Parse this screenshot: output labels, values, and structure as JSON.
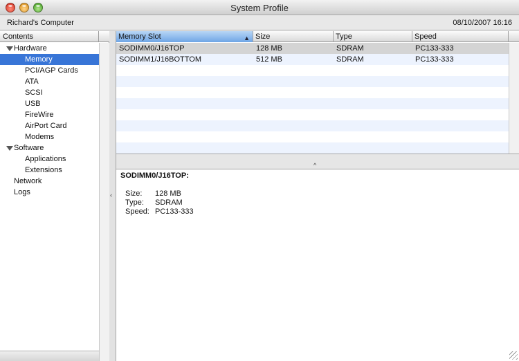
{
  "window": {
    "title": "System Profile"
  },
  "info": {
    "computer_name": "Richard's Computer",
    "datetime": "08/10/2007 16:16"
  },
  "sidebar": {
    "header": "Contents",
    "items": [
      {
        "label": "Hardware",
        "level": 0,
        "expanded": true
      },
      {
        "label": "Memory",
        "level": 1,
        "selected": true
      },
      {
        "label": "PCI/AGP Cards",
        "level": 1
      },
      {
        "label": "ATA",
        "level": 1
      },
      {
        "label": "SCSI",
        "level": 1
      },
      {
        "label": "USB",
        "level": 1
      },
      {
        "label": "FireWire",
        "level": 1
      },
      {
        "label": "AirPort Card",
        "level": 1
      },
      {
        "label": "Modems",
        "level": 1
      },
      {
        "label": "Software",
        "level": 0,
        "expanded": true
      },
      {
        "label": "Applications",
        "level": 1
      },
      {
        "label": "Extensions",
        "level": 1
      },
      {
        "label": "Network",
        "level": 0
      },
      {
        "label": "Logs",
        "level": 0
      }
    ]
  },
  "table": {
    "columns": [
      "Memory Slot",
      "Size",
      "Type",
      "Speed"
    ],
    "sort_indicator": "▲",
    "rows": [
      [
        "SODIMM0/J16TOP",
        "128 MB",
        "SDRAM",
        "PC133-333"
      ],
      [
        "SODIMM1/J16BOTTOM",
        "512 MB",
        "SDRAM",
        "PC133-333"
      ]
    ]
  },
  "detail": {
    "title": "SODIMM0/J16TOP:",
    "properties": [
      {
        "key": "Size:",
        "value": "128 MB"
      },
      {
        "key": "Type:",
        "value": "SDRAM"
      },
      {
        "key": "Speed:",
        "value": "PC133-333"
      }
    ]
  },
  "colors": {
    "selection": "#3875d7",
    "row_stripe": "#edf3fe",
    "row_selected": "#d4d4d4"
  }
}
